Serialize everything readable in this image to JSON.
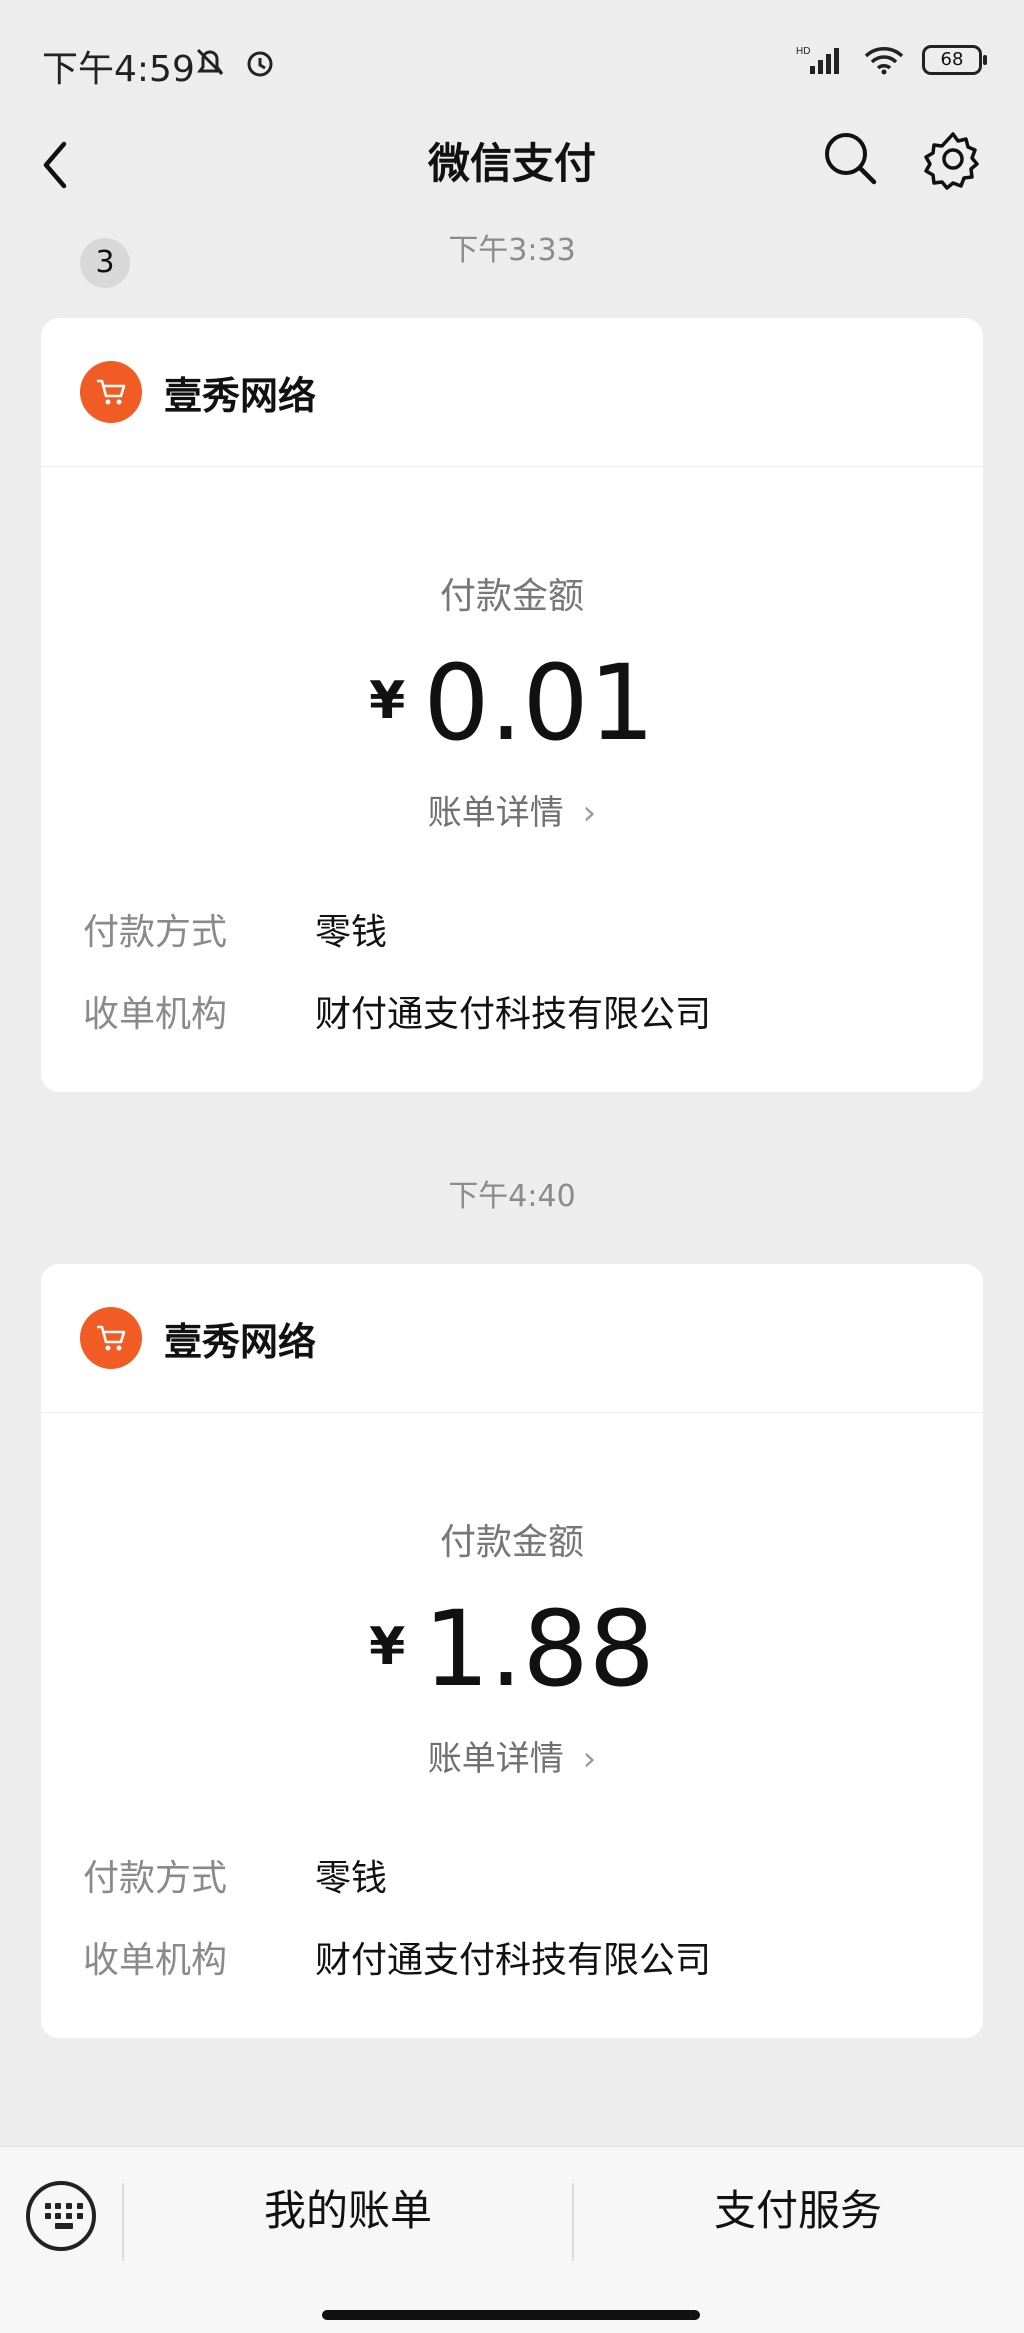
{
  "status_bar": {
    "time": "下午4:59",
    "battery": "68"
  },
  "nav": {
    "title": "微信支付",
    "back_badge": "3"
  },
  "messages": [
    {
      "time": "下午3:33",
      "merchant": "壹秀网络",
      "amount_label": "付款金额",
      "currency": "¥",
      "amount": "0.01",
      "detail_link": "账单详情",
      "rows": [
        {
          "key": "付款方式",
          "value": "零钱"
        },
        {
          "key": "收单机构",
          "value": "财付通支付科技有限公司"
        }
      ]
    },
    {
      "time": "下午4:40",
      "merchant": "壹秀网络",
      "amount_label": "付款金额",
      "currency": "¥",
      "amount": "1.88",
      "detail_link": "账单详情",
      "rows": [
        {
          "key": "付款方式",
          "value": "零钱"
        },
        {
          "key": "收单机构",
          "value": "财付通支付科技有限公司"
        }
      ]
    }
  ],
  "bottom_menu": {
    "item1": "我的账单",
    "item2": "支付服务"
  },
  "colors": {
    "merchant_icon": "#f05c23",
    "background": "#ededed"
  }
}
